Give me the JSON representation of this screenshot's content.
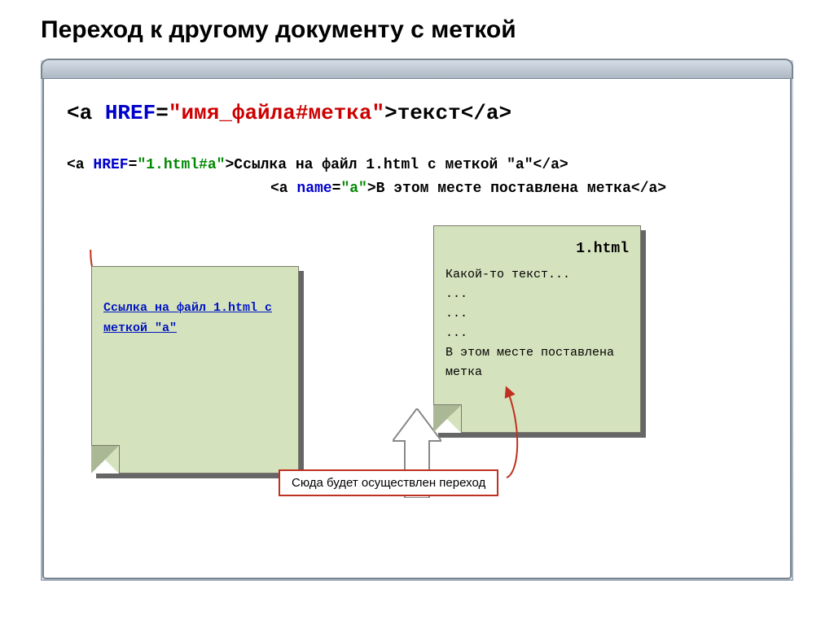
{
  "title": "Переход к другому документу с меткой",
  "code": {
    "line1": {
      "t1": "<a ",
      "t2": "HREF",
      "t3": "=",
      "t4": "\"имя_файла#метка\"",
      "t5": ">текст</a>"
    },
    "line2": {
      "t1": "<a ",
      "t2": "HREF",
      "t3": "=",
      "t4": "\"1.html#a\"",
      "t5": ">Ссылка на файл 1.html с меткой \"a\"</a>"
    },
    "line3": {
      "t1": "<a ",
      "t2": "name",
      "t3": "=",
      "t4": "\"a\"",
      "t5": ">В этом месте поставлена метка</a>"
    }
  },
  "doc_left": {
    "link_text": "Ссылка на файл 1.html с меткой \"a\""
  },
  "doc_right": {
    "filename": "1.html",
    "body": "Какой-то текст...\n...\n...\n...\nВ этом месте поставлена метка"
  },
  "callout": "Сюда будет осуществлен переход"
}
